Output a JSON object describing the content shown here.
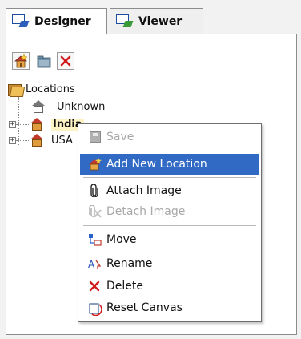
{
  "tabs": [
    {
      "label": "Designer",
      "active": true,
      "icon": "designer-icon"
    },
    {
      "label": "Viewer",
      "active": false,
      "icon": "viewer-icon"
    }
  ],
  "toolbar": {
    "buttons": [
      {
        "name": "add-location-button",
        "icon": "add-location-icon"
      },
      {
        "name": "move-button",
        "icon": "folder-move-icon"
      },
      {
        "name": "delete-button",
        "icon": "delete-x-icon"
      }
    ]
  },
  "tree": {
    "root": {
      "label": "Locations",
      "icon": "folder-icon"
    },
    "children": [
      {
        "label": "Unknown",
        "icon": "house-outline-icon"
      },
      {
        "label": "India",
        "icon": "house-icon",
        "selected": true,
        "expander": "+"
      },
      {
        "label": "USA",
        "icon": "house-icon",
        "expander": "+"
      }
    ]
  },
  "context_menu": {
    "items": [
      {
        "label": "Save",
        "icon": "save-icon",
        "disabled": true
      },
      {
        "label": "Add New Location",
        "icon": "add-location-icon",
        "highlighted": true
      },
      {
        "label": "Attach Image",
        "icon": "paperclip-icon"
      },
      {
        "label": "Detach Image",
        "icon": "detach-image-icon",
        "disabled": true
      },
      {
        "label": "Move",
        "icon": "move-icon"
      },
      {
        "label": "Rename",
        "icon": "rename-icon"
      },
      {
        "label": "Delete",
        "icon": "delete-x-icon"
      },
      {
        "label": "Reset Canvas",
        "icon": "reset-canvas-icon"
      }
    ]
  },
  "colors": {
    "highlight": "#316ac5",
    "delete_red": "#d01818",
    "selected_node_bg": "#fdf3c5"
  }
}
